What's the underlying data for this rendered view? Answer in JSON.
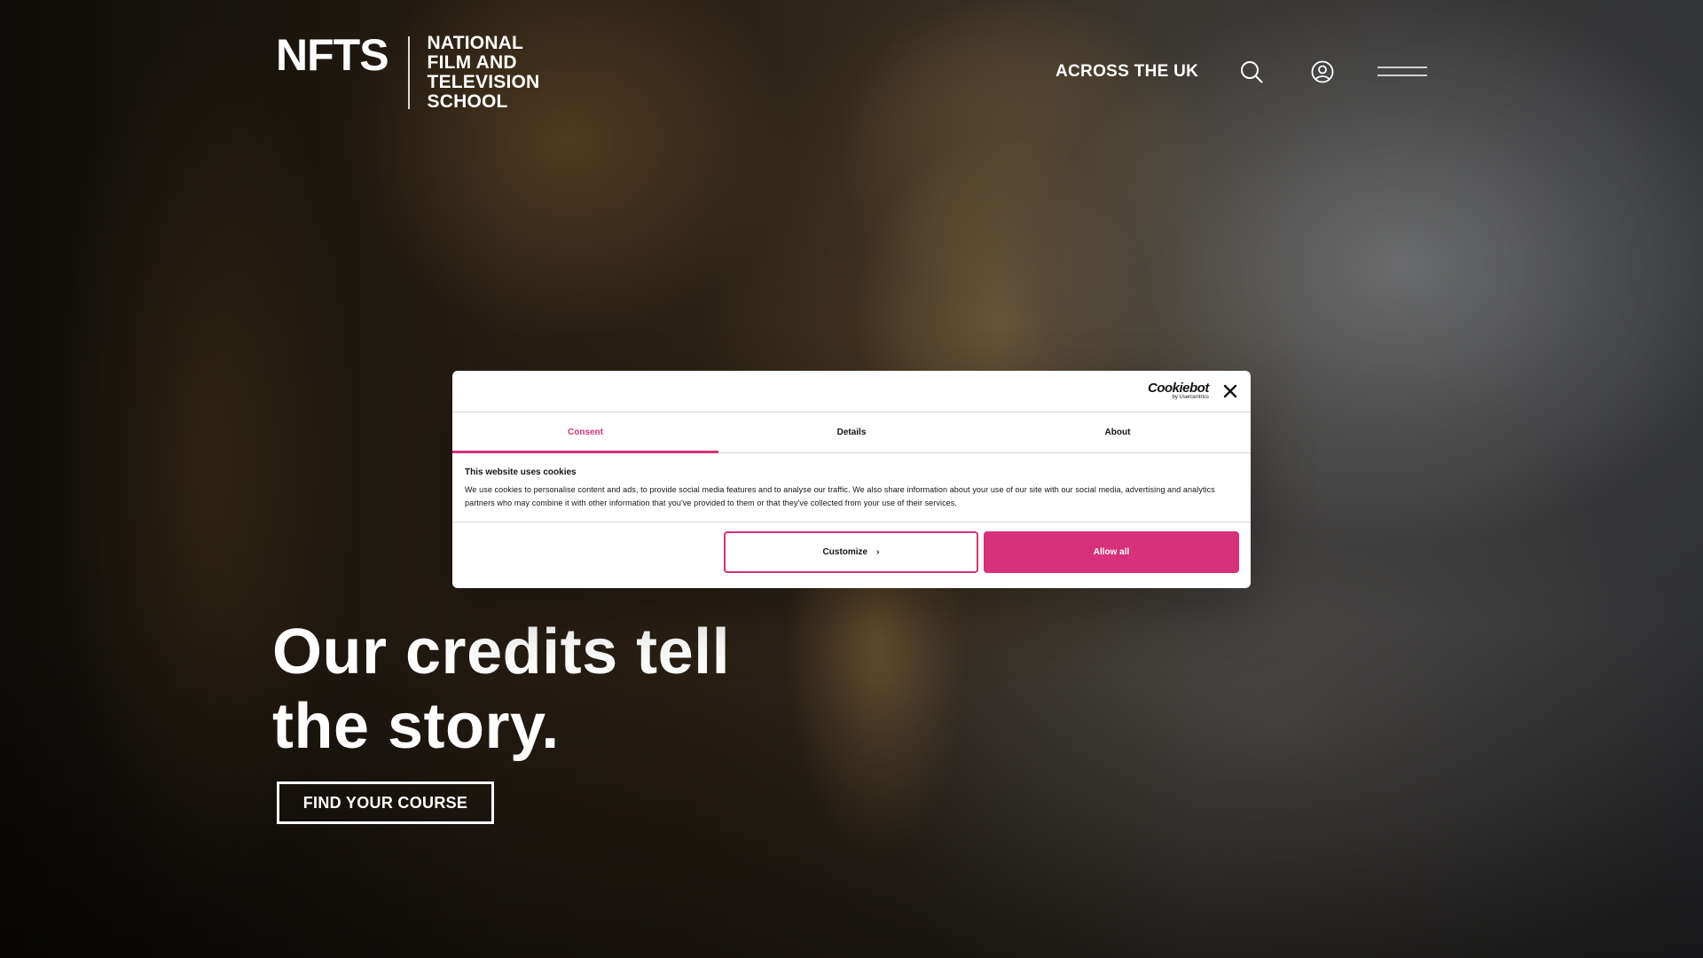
{
  "header": {
    "logo_mark": "NFTS",
    "logo_lines": [
      "NATIONAL",
      "FILM AND",
      "TELEVISION",
      "SCHOOL"
    ],
    "nav_link": "ACROSS THE UK",
    "icons": [
      "search-icon",
      "account-icon",
      "hamburger-menu-icon"
    ]
  },
  "hero": {
    "title_line1": "Our credits tell",
    "title_line2": "the story.",
    "cta_label": "FIND YOUR COURSE"
  },
  "cookie_dialog": {
    "brand": "Cookiebot",
    "brand_sub": "by Usercentrics",
    "tabs": [
      {
        "label": "Consent",
        "active": true
      },
      {
        "label": "Details",
        "active": false
      },
      {
        "label": "About",
        "active": false
      }
    ],
    "heading": "This website uses cookies",
    "body": "We use cookies to personalise content and ads, to provide social media features and to analyse our traffic. We also share information about your use of our site with our social media, advertising and analytics partners who may combine it with other information that you've provided to them or that they've collected from your use of their services.",
    "customize_label": "Customize",
    "allow_label": "Allow all"
  },
  "colors": {
    "accent": "#d6317a",
    "text_dark": "#141414",
    "white": "#ffffff"
  }
}
